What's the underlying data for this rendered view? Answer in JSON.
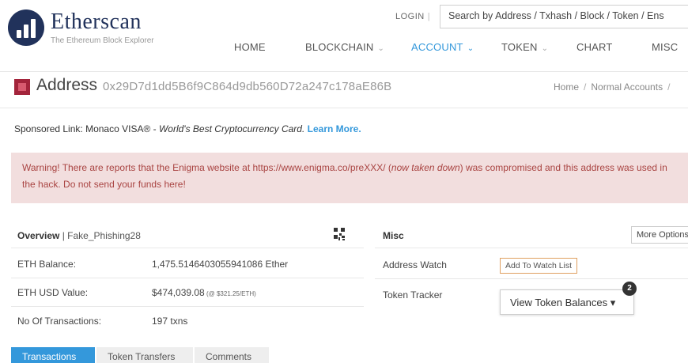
{
  "brand": {
    "name": "Etherscan",
    "tagline": "The Ethereum Block Explorer",
    "color": "#21325b"
  },
  "top": {
    "login": "LOGIN",
    "login_sep": "|",
    "search_placeholder": "Search by Address / Txhash / Block / Token / Ens"
  },
  "nav": {
    "home": "HOME",
    "blockchain": "BLOCKCHAIN",
    "account": "ACCOUNT",
    "token": "TOKEN",
    "chart": "CHART",
    "misc": "MISC",
    "active": "ACCOUNT",
    "accent_color": "#3498db"
  },
  "address": {
    "label": "Address",
    "hash": "0x29D7d1dd5B6f9C864d9db560D72a247c178aE86B"
  },
  "breadcrumb": {
    "home": "Home",
    "sep": "/",
    "current": "Normal Accounts",
    "trail": "/"
  },
  "sponsor": {
    "prefix": "Sponsored Link:",
    "brand": "Monaco VISA®",
    "dash": " - ",
    "slogan": "World's Best Cryptocurrency Card.",
    "link": "Learn More."
  },
  "alert": {
    "part1": "Warning! There are reports that the Enigma website at https://www.enigma.co/preXXX/ (",
    "italic": "now taken down",
    "part2": ") was compromised and this address was used in the hack. Do not send your funds here!",
    "bg_color": "#f2dede",
    "text_color": "#a94442"
  },
  "overview": {
    "title": "Overview",
    "sep": " | ",
    "subtitle": "Fake_Phishing28",
    "rows": [
      {
        "label": "ETH Balance:",
        "value": "1,475.5146403055941086 Ether",
        "extra": ""
      },
      {
        "label": "ETH USD Value:",
        "value": "$474,039.08",
        "extra": " (@ $321.25/ETH)"
      },
      {
        "label": "No Of Transactions:",
        "value": "197 txns",
        "extra": ""
      }
    ]
  },
  "misc": {
    "title": "Misc",
    "more_options": "More Options",
    "watch_label": "Address Watch",
    "watch_button": "Add To Watch List",
    "tracker_label": "Token Tracker",
    "tracker_button": "View Token Balances ▾",
    "badge": "2"
  },
  "tabs": {
    "transactions": "Transactions",
    "token_transfers": "Token Transfers",
    "comments": "Comments",
    "active": "Transactions"
  },
  "icons": {
    "logo": "etherscan-logo",
    "address": "address-identicon",
    "qr": "qr-code-icon"
  }
}
